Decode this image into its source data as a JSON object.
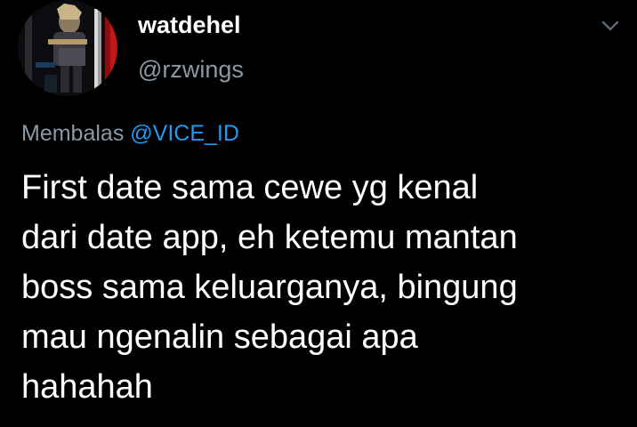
{
  "author": {
    "display_name": "watdehel",
    "handle": "@rzwings",
    "avatar_icon": "profile-photo"
  },
  "menu": {
    "icon": "chevron-down-icon"
  },
  "reply": {
    "prefix": "Membalas",
    "mention": "@VICE_ID"
  },
  "tweet": {
    "lines": [
      "First date sama cewe yg kenal",
      "dari date app, eh ketemu mantan",
      "boss sama keluarganya, bingung",
      "mau ngenalin sebagai apa",
      "hahahah"
    ]
  },
  "colors": {
    "background": "#000000",
    "text": "#ffffff",
    "secondary_text": "#8b98a5",
    "link": "#1d9bf0"
  }
}
